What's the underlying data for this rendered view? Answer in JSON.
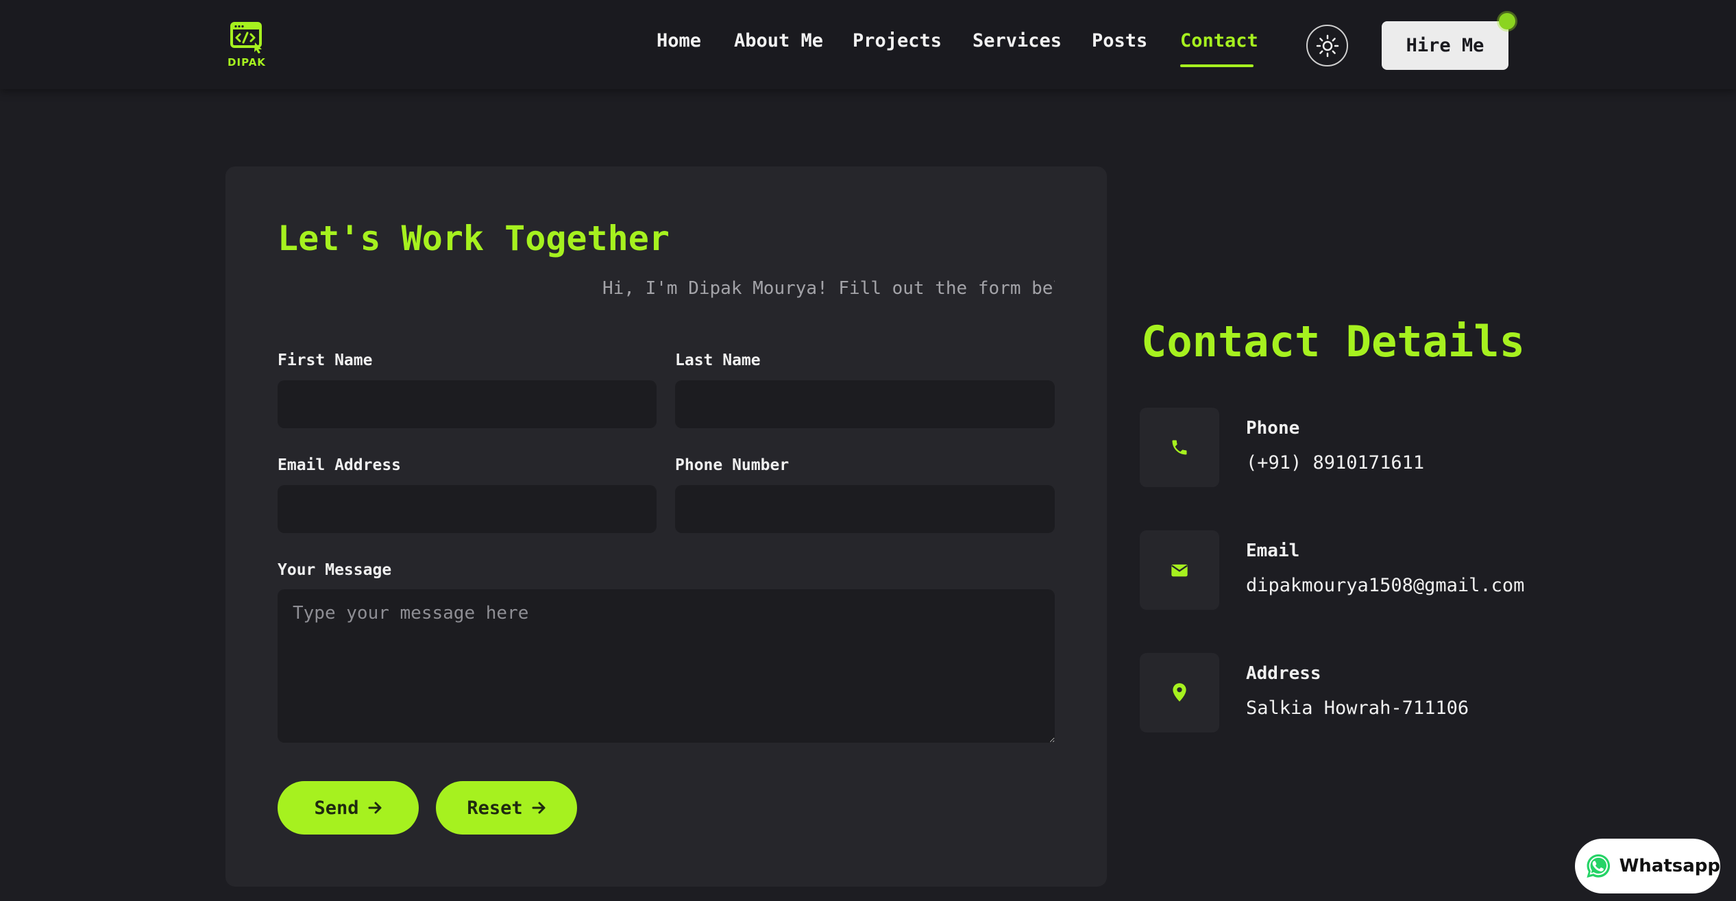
{
  "brand": {
    "logo_text": "DIPAK"
  },
  "nav": {
    "items": [
      {
        "label": "Home"
      },
      {
        "label": "About Me"
      },
      {
        "label": "Projects"
      },
      {
        "label": "Services"
      },
      {
        "label": "Posts"
      },
      {
        "label": "Contact"
      }
    ],
    "active": "Contact",
    "hire_label": "Hire Me"
  },
  "form": {
    "title": "Let's Work Together",
    "subtitle": "Hi, I'm Dipak Mourya! Fill out the form bel",
    "first_name": {
      "label": "First Name",
      "value": ""
    },
    "last_name": {
      "label": "Last Name",
      "value": ""
    },
    "email": {
      "label": "Email Address",
      "value": ""
    },
    "phone": {
      "label": "Phone Number",
      "value": ""
    },
    "message": {
      "label": "Your Message",
      "placeholder": "Type your message here",
      "value": ""
    },
    "send_label": "Send",
    "reset_label": "Reset"
  },
  "details": {
    "title": "Contact Details",
    "phone": {
      "label": "Phone",
      "value": "(+91) 8910171611"
    },
    "email": {
      "label": "Email",
      "value": "dipakmourya1508@gmail.com"
    },
    "address": {
      "label": "Address",
      "value": "Salkia Howrah-711106"
    }
  },
  "whatsapp": {
    "label": "Whatsapp"
  },
  "colors": {
    "accent": "#a6f11f",
    "background": "#1d1d22",
    "card": "#26262b",
    "input": "#1c1c20"
  }
}
